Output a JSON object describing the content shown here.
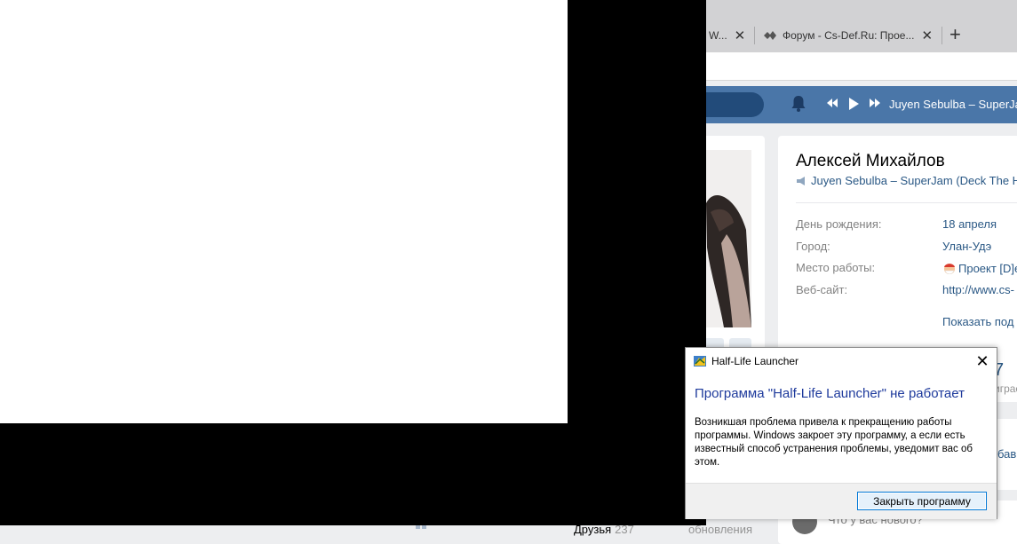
{
  "browser": {
    "tabs": [
      {
        "label": "W..."
      },
      {
        "label": "Форум - Cs-Def.Ru: Прое..."
      }
    ]
  },
  "vk": {
    "header": {
      "now_playing": "Juyen Sebulba – SuperJam"
    },
    "profile": {
      "name": "Алексей Михайлов",
      "status": "Juyen Sebulba – SuperJam (Deck The H",
      "info": [
        {
          "label": "День рождения:",
          "value": "18 апреля"
        },
        {
          "label": "Город:",
          "value": "Улан-Удэ"
        },
        {
          "label": "Место работы:",
          "value": "Проект [D]e"
        },
        {
          "label": "Веб-сайт:",
          "value": "http://www.cs-"
        }
      ],
      "show_more": "Показать под",
      "counter_value": "7",
      "counter_label": "играс",
      "add_link": "бав"
    },
    "post_placeholder": "Что у вас нового?",
    "friends_label": "Друзья",
    "friends_count": "237",
    "updates_label": "обновления"
  },
  "dialog": {
    "title": "Half-Life Launcher",
    "heading": "Программа \"Half-Life Launcher\" не работает",
    "message": "Возникшая проблема привела к прекращению работы программы. Windows закроет эту программу, а если есть известный способ устранения проблемы, уведомит вас об этом.",
    "button_label": "Закрыть программу"
  },
  "colors": {
    "vk_header": "#4a76a8",
    "vk_link": "#2a5885",
    "dialog_heading": "#1e3a9c",
    "button_border": "#0078d7"
  }
}
